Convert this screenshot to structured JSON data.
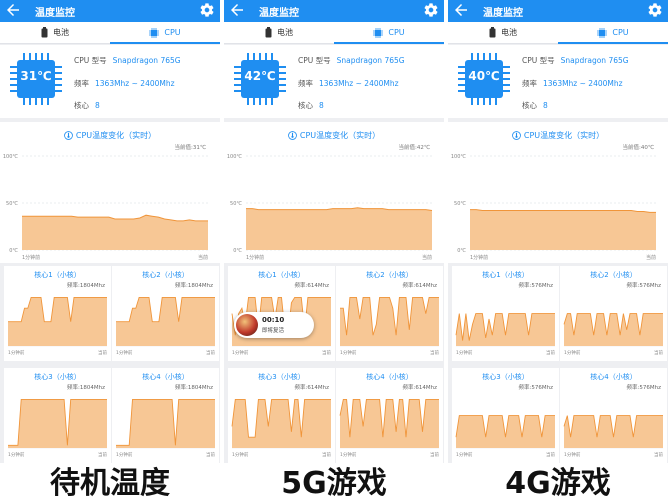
{
  "colors": {
    "accent": "#1f8ef1",
    "chart_fill": "#f7c795",
    "chart_line": "#f0953a",
    "background": "#eeeff2"
  },
  "icons": {
    "back": "arrow-left-icon",
    "settings": "gear-icon",
    "battery": "battery-icon",
    "cpu": "cpu-chip-icon",
    "thermometer": "thermometer-icon"
  },
  "panels": [
    {
      "title": "温度监控",
      "tabs": [
        "电池",
        "CPU"
      ],
      "temp": "31℃",
      "cpu_model_label": "CPU 型号",
      "cpu_model": "Snapdragon 765G",
      "freq_label": "频率",
      "freq": "1363Mhz ~ 2400Mhz",
      "cores_label": "核心",
      "cores": "8",
      "temp_title": "CPU温度变化（实时）",
      "current_label": "当前值:31℃",
      "y_ticks": [
        "100℃",
        "50℃",
        "0℃"
      ],
      "x_left": "1分钟前",
      "x_right": "当前",
      "core_cards": [
        {
          "name": "核心1（小核）",
          "freq": "频率:1804Mhz"
        },
        {
          "name": "核心2（小核）",
          "freq": "频率:1804Mhz"
        },
        {
          "name": "核心3（小核）",
          "freq": "频率:1804Mhz"
        },
        {
          "name": "核心4（小核）",
          "freq": "频率:1804Mhz"
        }
      ],
      "core_axis": [
        "1分钟前",
        "当前"
      ],
      "caption": "待机温度"
    },
    {
      "title": "温度监控",
      "tabs": [
        "电池",
        "CPU"
      ],
      "temp": "42℃",
      "cpu_model_label": "CPU 型号",
      "cpu_model": "Snapdragon 765G",
      "freq_label": "频率",
      "freq": "1363Mhz ~ 2400Mhz",
      "cores_label": "核心",
      "cores": "8",
      "temp_title": "CPU温度变化（实时）",
      "current_label": "当前值:42℃",
      "y_ticks": [
        "100℃",
        "50℃",
        "0℃"
      ],
      "x_left": "1分钟前",
      "x_right": "当前",
      "core_cards": [
        {
          "name": "核心1（小核）",
          "freq": "频率:614Mhz"
        },
        {
          "name": "核心2（小核）",
          "freq": "频率:614Mhz"
        },
        {
          "name": "核心3（小核）",
          "freq": "频率:614Mhz"
        },
        {
          "name": "核心4（小核）",
          "freq": "频率:614Mhz"
        }
      ],
      "core_axis": [
        "1分钟前",
        "当前"
      ],
      "overlay": {
        "time": "00:10",
        "text": "即将复活"
      },
      "caption": "5G游戏"
    },
    {
      "title": "温度监控",
      "tabs": [
        "电池",
        "CPU"
      ],
      "temp": "40℃",
      "cpu_model_label": "CPU 型号",
      "cpu_model": "Snapdragon 765G",
      "freq_label": "频率",
      "freq": "1363Mhz ~ 2400Mhz",
      "cores_label": "核心",
      "cores": "8",
      "temp_title": "CPU温度变化（实时）",
      "current_label": "当前值:40℃",
      "y_ticks": [
        "100℃",
        "50℃",
        "0℃"
      ],
      "x_left": "1分钟前",
      "x_right": "当前",
      "core_cards": [
        {
          "name": "核心1（小核）",
          "freq": "频率:576Mhz"
        },
        {
          "name": "核心2（小核）",
          "freq": "频率:576Mhz"
        },
        {
          "name": "核心3（小核）",
          "freq": "频率:576Mhz"
        },
        {
          "name": "核心4（小核）",
          "freq": "频率:576Mhz"
        }
      ],
      "core_axis": [
        "1分钟前",
        "当前"
      ],
      "caption": "4G游戏"
    }
  ],
  "chart_data": [
    {
      "type": "area",
      "series": [
        {
          "values": [
            36,
            36,
            36,
            36,
            36,
            36,
            36,
            36,
            36,
            35,
            35,
            35,
            35,
            35,
            35,
            33,
            33,
            33,
            33,
            34,
            37,
            36,
            35,
            33,
            32,
            31,
            31,
            32,
            31,
            31,
            31
          ]
        }
      ],
      "ylim": [
        0,
        100
      ],
      "y_ticks": [
        "100℃",
        "50℃",
        "0℃"
      ],
      "x_labels": [
        "1分钟前",
        "当前"
      ]
    },
    {
      "type": "area",
      "series": [
        {
          "values": [
            44,
            44,
            43,
            43,
            43,
            43,
            43,
            43,
            43,
            43,
            43,
            43,
            43,
            43,
            44,
            44,
            44,
            44,
            45,
            44,
            44,
            44,
            44,
            43,
            43,
            43,
            43,
            43,
            43,
            43,
            42
          ]
        }
      ],
      "ylim": [
        0,
        100
      ],
      "y_ticks": [
        "100℃",
        "50℃",
        "0℃"
      ],
      "x_labels": [
        "1分钟前",
        "当前"
      ]
    },
    {
      "type": "area",
      "series": [
        {
          "values": [
            43,
            43,
            42,
            42,
            42,
            42,
            42,
            42,
            42,
            42,
            42,
            42,
            42,
            42,
            42,
            42,
            42,
            42,
            42,
            42,
            42,
            42,
            42,
            42,
            42,
            42,
            42,
            41,
            41,
            40,
            40
          ]
        }
      ],
      "ylim": [
        0,
        100
      ],
      "y_ticks": [
        "100℃",
        "50℃",
        "0℃"
      ],
      "x_labels": [
        "1分钟前",
        "当前"
      ]
    }
  ]
}
